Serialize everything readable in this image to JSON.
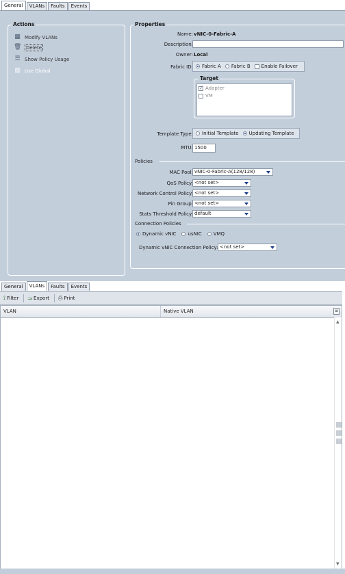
{
  "top_tabs": [
    "General",
    "VLANs",
    "Faults",
    "Events"
  ],
  "actions": {
    "title": "Actions",
    "items": [
      {
        "label": "Modify VLANs",
        "icon": "modify-icon"
      },
      {
        "label": "Delete",
        "icon": "delete-icon"
      },
      {
        "label": "Show Policy Usage",
        "icon": "policy-usage-icon"
      },
      {
        "label": "Use Global",
        "icon": "use-global-icon"
      }
    ]
  },
  "properties": {
    "title": "Properties",
    "name_label": "Name:",
    "name_value": "vNIC-0-Fabric-A",
    "description_label": "Description:",
    "description_value": "",
    "owner_label": "Owner:",
    "owner_value": "Local",
    "fabric_label": "Fabric ID:",
    "fabric_options": [
      "Fabric A",
      "Fabric B"
    ],
    "fabric_selected": "Fabric A",
    "enable_failover": "Enable Failover",
    "target": {
      "title": "Target",
      "items": [
        {
          "label": "Adapter",
          "checked": true
        },
        {
          "label": "VM",
          "checked": false
        }
      ]
    },
    "template_type_label": "Template Type:",
    "template_options": [
      "Initial Template",
      "Updating Template"
    ],
    "template_selected": "Updating Template",
    "mtu_label": "MTU:",
    "mtu_value": "1500",
    "policies_label": "Policies",
    "mac_pool_label": "MAC Pool:",
    "mac_pool_value": "vNIC-0-Fabric-A(128/128)",
    "qos_label": "QoS Policy:",
    "qos_value": "<not set>",
    "netctrl_label": "Network Control Policy:",
    "netctrl_value": "<not set>",
    "pin_label": "Pin Group:",
    "pin_value": "<not set>",
    "stats_label": "Stats Threshold Policy:",
    "stats_value": "default",
    "conn_policies_label": "Connection Policies",
    "conn_options": [
      "Dynamic vNIC",
      "usNIC",
      "VMQ"
    ],
    "conn_selected": "Dynamic vNIC",
    "dyn_conn_label": "Dynamic vNIC Connection Policy:",
    "dyn_conn_value": "<not set>"
  },
  "bottom_tabs": [
    "General",
    "VLANs",
    "Faults",
    "Events"
  ],
  "toolbar": {
    "filter": "Filter",
    "export": "Export",
    "print": "Print"
  },
  "table": {
    "columns": [
      "VLAN",
      "Native VLAN"
    ],
    "rows": []
  }
}
